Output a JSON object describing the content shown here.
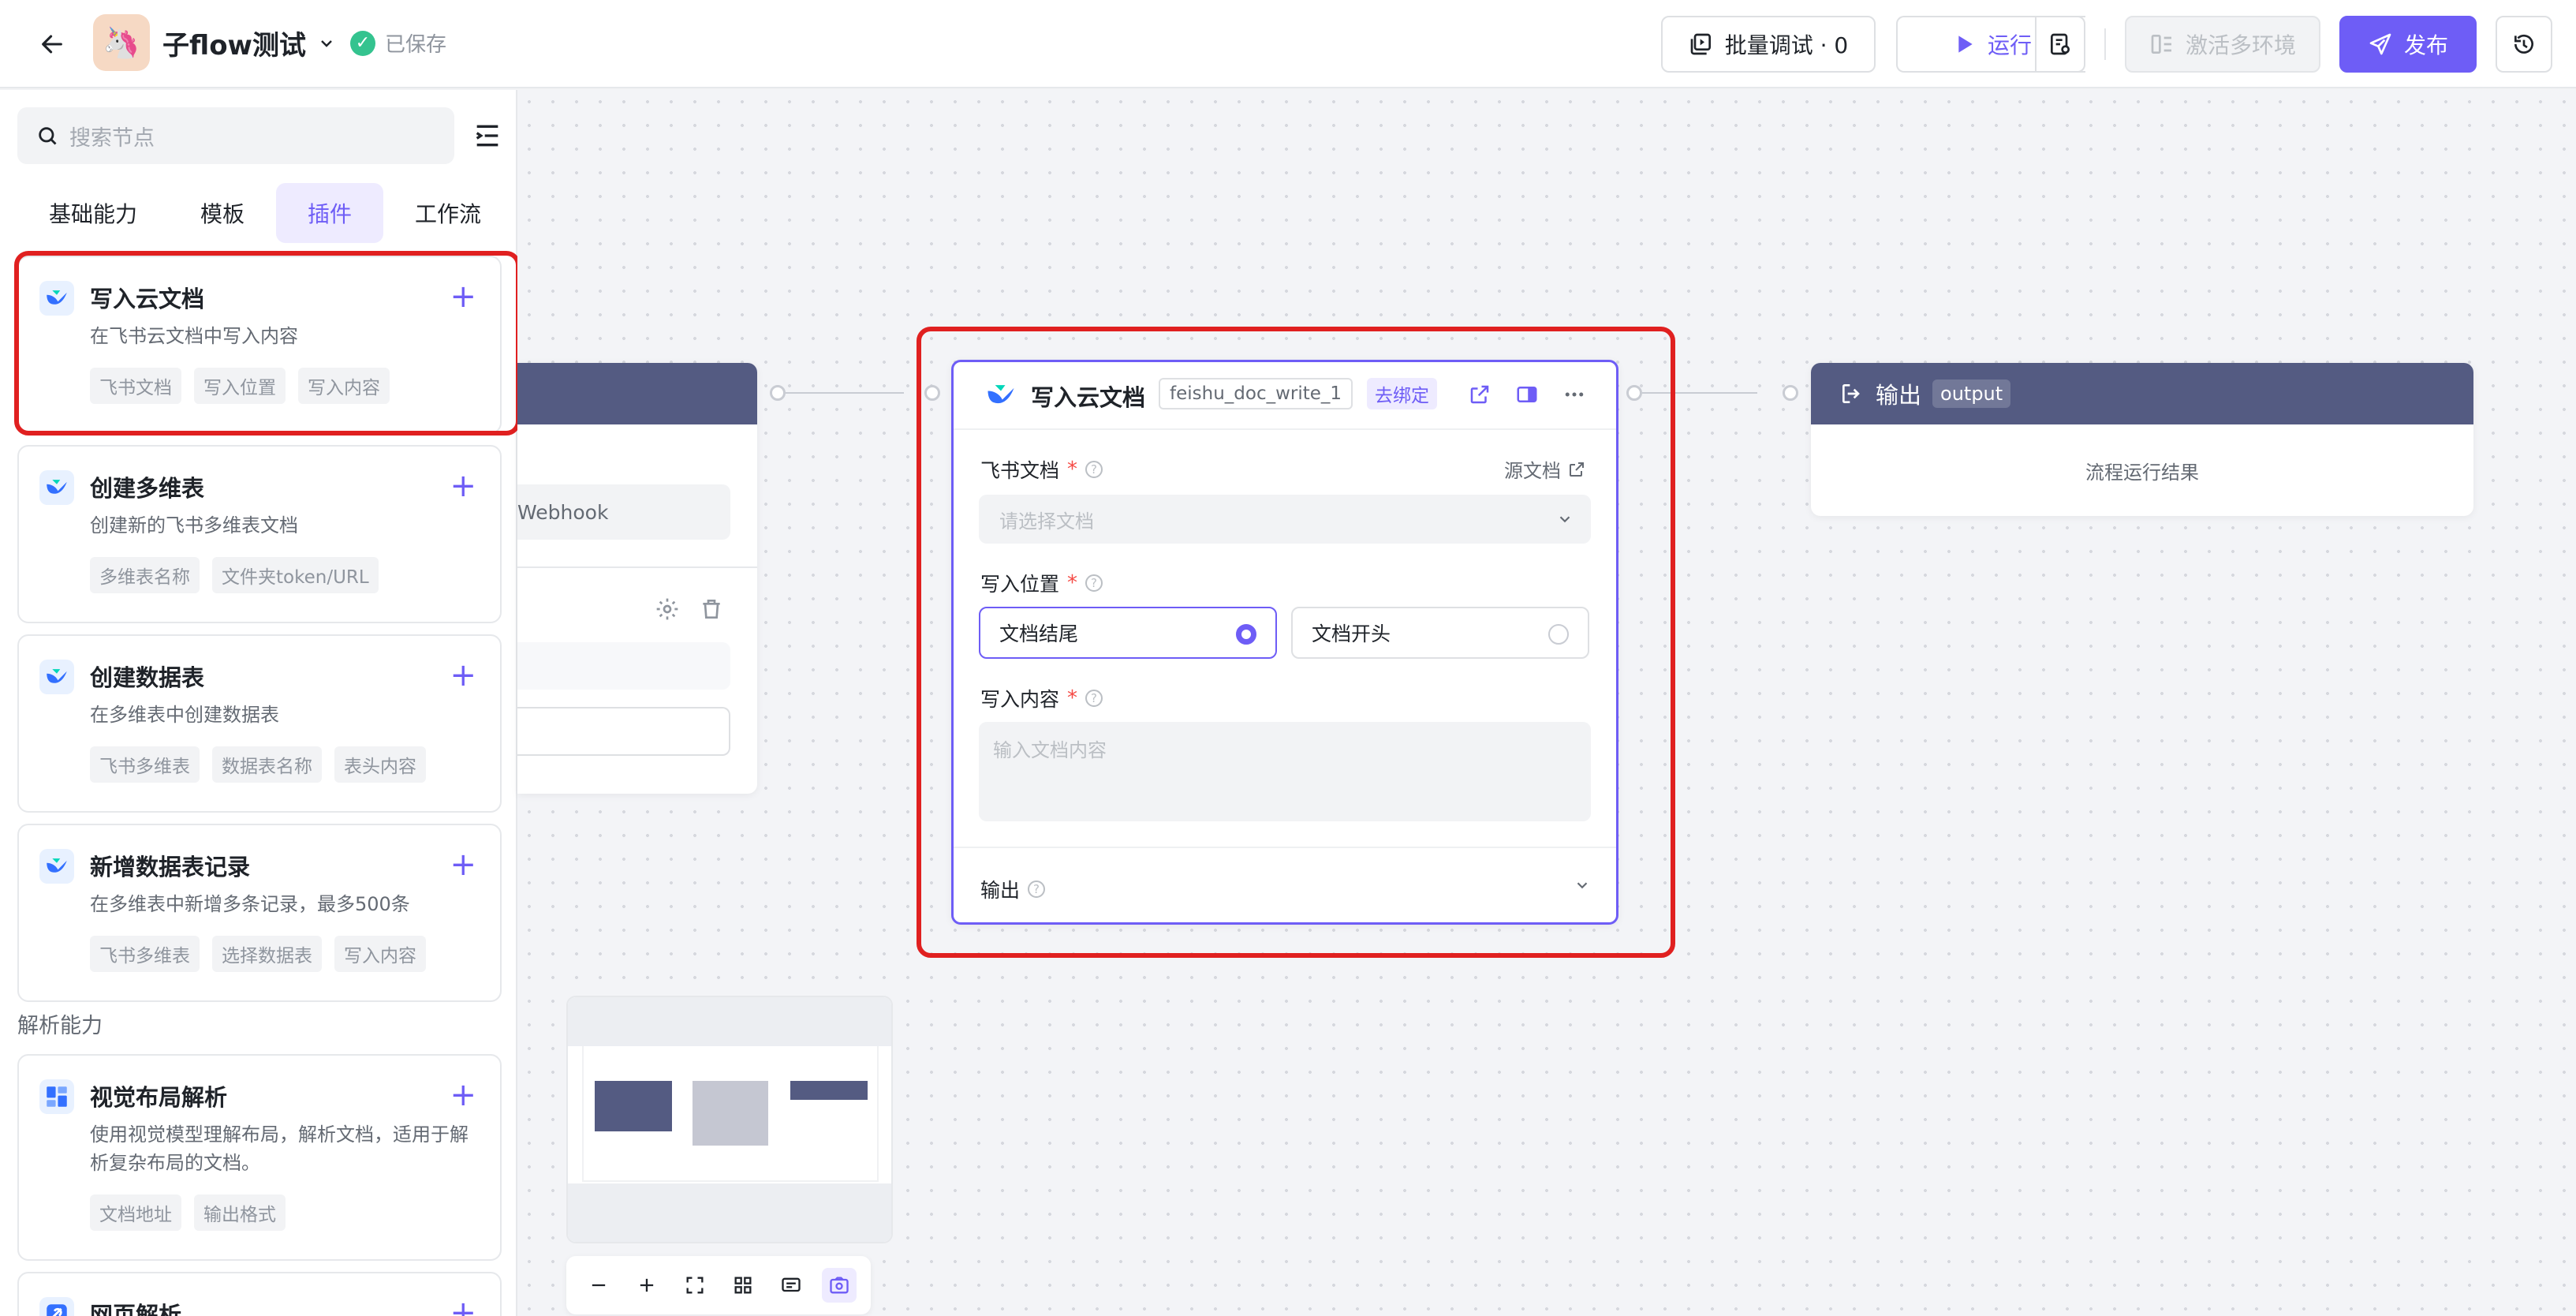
{
  "topbar": {
    "title": "子flow测试",
    "saved_label": "已保存",
    "batch_debug_label": "批量调试 · 0",
    "run_label": "运行",
    "activate_env_label": "激活多环境",
    "publish_label": "发布"
  },
  "sidebar": {
    "search_placeholder": "搜索节点",
    "tabs": [
      "基础能力",
      "模板",
      "插件",
      "工作流"
    ],
    "active_tab": "插件",
    "plugins": [
      {
        "title": "写入云文档",
        "desc": "在飞书云文档中写入内容",
        "tags": [
          "飞书文档",
          "写入位置",
          "写入内容"
        ]
      },
      {
        "title": "创建多维表",
        "desc": "创建新的飞书多维表文档",
        "tags": [
          "多维表名称",
          "文件夹token/URL"
        ]
      },
      {
        "title": "创建数据表",
        "desc": "在多维表中创建数据表",
        "tags": [
          "飞书多维表",
          "数据表名称",
          "表头内容"
        ]
      },
      {
        "title": "新增数据表记录",
        "desc": "在多维表中新增多条记录，最多500条",
        "tags": [
          "飞书多维表",
          "选择数据表",
          "写入内容"
        ]
      }
    ],
    "section_parse": "解析能力",
    "parse_items": [
      {
        "title": "视觉布局解析",
        "desc": "使用视觉模型理解布局，解析文档，适用于解析复杂布局的文档。",
        "tags": [
          "文档地址",
          "输出格式"
        ]
      },
      {
        "title": "网页解析",
        "desc": "",
        "tags": []
      }
    ]
  },
  "canvas": {
    "left_node_partial_text": "Webhook",
    "doc_node": {
      "title": "写入云文档",
      "id_badge": "feishu_doc_write_1",
      "unbind_label": "去绑定",
      "field_doc_label": "飞书文档",
      "source_doc_label": "源文档",
      "doc_select_placeholder": "请选择文档",
      "field_position_label": "写入位置",
      "position_options": [
        "文档结尾",
        "文档开头"
      ],
      "position_selected": "文档结尾",
      "field_content_label": "写入内容",
      "content_placeholder": "输入文档内容",
      "output_label": "输出"
    },
    "output_node": {
      "title": "输出",
      "badge": "output",
      "body_text": "流程运行结果"
    }
  },
  "colors": {
    "accent": "#6e5df6",
    "highlight": "#e02020",
    "node_header": "#545b82"
  }
}
